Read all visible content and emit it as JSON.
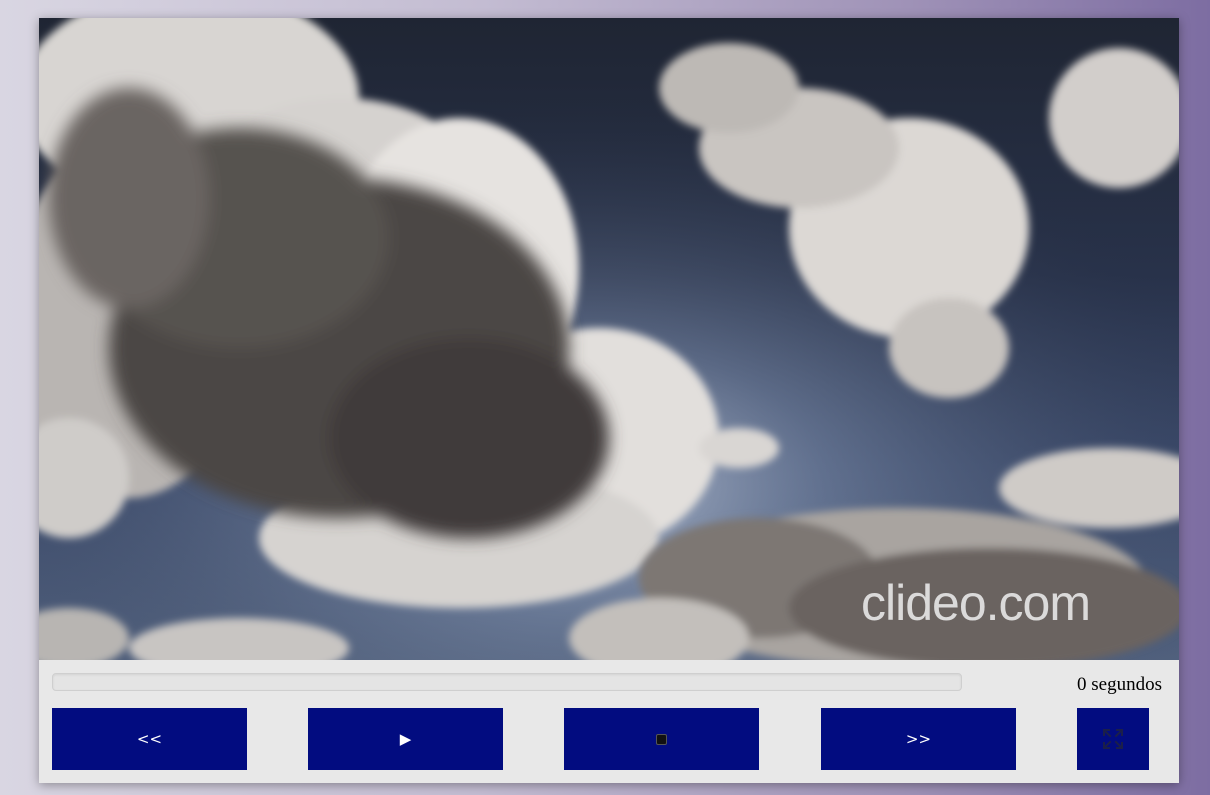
{
  "video": {
    "watermark": "clideo.com"
  },
  "progress": {
    "fraction": 0
  },
  "time": {
    "label": "0 segundos"
  },
  "controls": {
    "rewind_label": "<<",
    "play_label": "▶",
    "forward_label": ">>",
    "stop_icon": "stop-square-icon",
    "fullscreen_icon": "fullscreen-icon",
    "button_color": "#020c80"
  }
}
